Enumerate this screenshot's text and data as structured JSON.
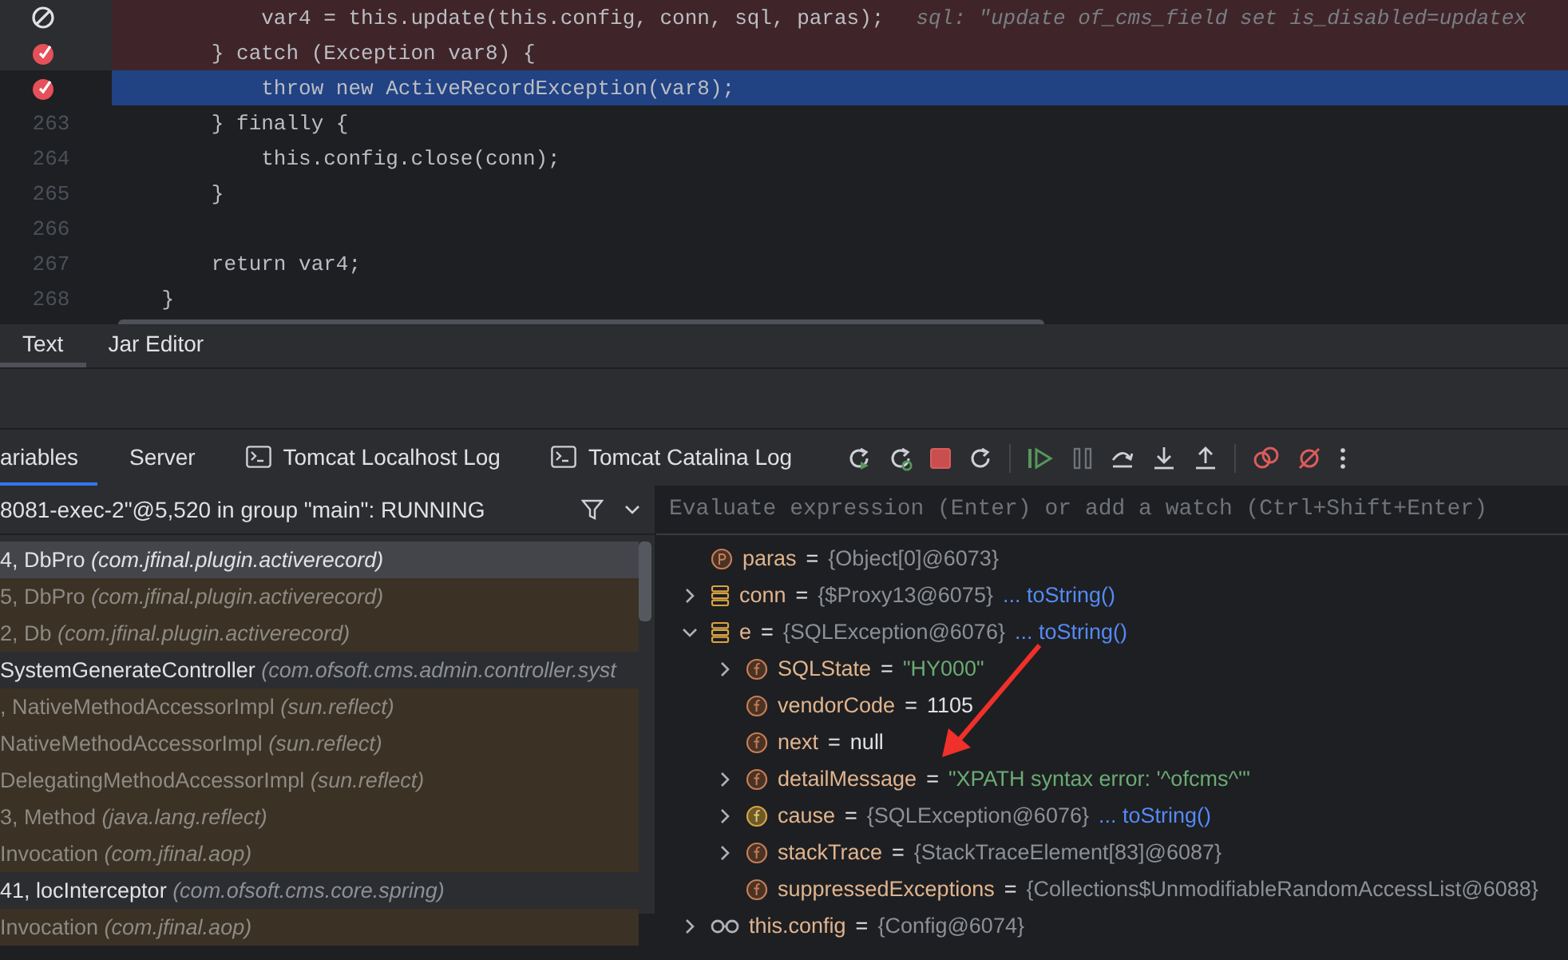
{
  "editor": {
    "lines": [
      {
        "breakpoint": true,
        "muted": true,
        "error": true,
        "current": false,
        "code": "            var4 = this.update(this.config, conn, sql, paras);",
        "hint": "sql: \"update of_cms_field set is_disabled=updatex"
      },
      {
        "breakpoint": true,
        "muted": false,
        "error": true,
        "current": false,
        "code": "        } catch (Exception var8) {"
      },
      {
        "breakpoint": true,
        "muted": false,
        "error": false,
        "current": true,
        "code": "            throw new ActiveRecordException(var8);"
      },
      {
        "number": "263",
        "breakpoint": false,
        "error": false,
        "current": false,
        "code": "        } finally {"
      },
      {
        "number": "264",
        "breakpoint": false,
        "error": false,
        "current": false,
        "code": "            this.config.close(conn);"
      },
      {
        "number": "265",
        "breakpoint": false,
        "error": false,
        "current": false,
        "code": "        }"
      },
      {
        "number": "266",
        "breakpoint": false
      },
      {
        "number": "267",
        "breakpoint": false,
        "error": false,
        "current": false,
        "code": "        return var4;"
      },
      {
        "number": "268",
        "breakpoint": false,
        "error": false,
        "current": false,
        "code": "    }"
      }
    ]
  },
  "editor_tabs": [
    {
      "label": "Text",
      "selected": true
    },
    {
      "label": "Jar Editor",
      "selected": false
    }
  ],
  "debug_tabs": [
    {
      "label": "ariables",
      "kind": "view",
      "selected": true
    },
    {
      "label": "Server",
      "kind": "view",
      "selected": false
    },
    {
      "label": "Tomcat Localhost Log",
      "kind": "log",
      "selected": false
    },
    {
      "label": "Tomcat Catalina Log",
      "kind": "log",
      "selected": false
    }
  ],
  "thread": {
    "label": "8081-exec-2\"@5,520 in group \"main\": RUNNING"
  },
  "evaluate": {
    "placeholder": "Evaluate expression (Enter) or add a watch (Ctrl+Shift+Enter)"
  },
  "frames": [
    {
      "method": "4, DbPro",
      "package": "(com.jfinal.plugin.activerecord)",
      "kind": "app",
      "selected": true
    },
    {
      "method": "5, DbPro",
      "package": "(com.jfinal.plugin.activerecord)",
      "kind": "library",
      "selected": false
    },
    {
      "method": "2, Db",
      "package": "(com.jfinal.plugin.activerecord)",
      "kind": "library",
      "selected": false
    },
    {
      "method": "SystemGenerateController",
      "package": "(com.ofsoft.cms.admin.controller.syst",
      "kind": "app",
      "selected": false
    },
    {
      "method": ", NativeMethodAccessorImpl",
      "package": "(sun.reflect)",
      "kind": "library",
      "selected": false
    },
    {
      "method": "NativeMethodAccessorImpl",
      "package": "(sun.reflect)",
      "kind": "library",
      "selected": false
    },
    {
      "method": "DelegatingMethodAccessorImpl",
      "package": "(sun.reflect)",
      "kind": "library",
      "selected": false
    },
    {
      "method": "3, Method",
      "package": "(java.lang.reflect)",
      "kind": "library",
      "selected": false
    },
    {
      "method": "Invocation",
      "package": "(com.jfinal.aop)",
      "kind": "library",
      "selected": false
    },
    {
      "method": "41, locInterceptor",
      "package": "(com.ofsoft.cms.core.spring)",
      "kind": "app",
      "selected": false
    },
    {
      "method": "Invocation",
      "package": "(com.jfinal.aop)",
      "kind": "library",
      "selected": false
    }
  ],
  "variables": [
    {
      "kind": "parameter",
      "name": "paras",
      "operator": "=",
      "value": "{Object[0]@6073}",
      "string": false,
      "primitive": false
    },
    {
      "kind": "object",
      "expanded": false,
      "name": "conn",
      "operator": "=",
      "value": "{$Proxy13@6075}",
      "string": false,
      "primitive": false,
      "link": "... toString()"
    },
    {
      "kind": "object",
      "expanded": true,
      "name": "e",
      "operator": "=",
      "value": "{SQLException@6076}",
      "string": false,
      "primitive": false,
      "link": "... toString()",
      "children": [
        {
          "kind": "field",
          "expanded": false,
          "name": "SQLState",
          "operator": "=",
          "value": "\"HY000\"",
          "string": true,
          "primitive": false
        },
        {
          "kind": "field",
          "name": "vendorCode",
          "operator": "=",
          "value": "1105",
          "string": false,
          "primitive": true
        },
        {
          "kind": "field",
          "name": "next",
          "operator": "=",
          "value": "null",
          "string": false,
          "primitive": true
        },
        {
          "kind": "field",
          "expanded": false,
          "name": "detailMessage",
          "operator": "=",
          "value": "\"XPATH syntax error: '^ofcms^'\"",
          "string": true,
          "primitive": false
        },
        {
          "kind": "field-recursive",
          "expanded": false,
          "name": "cause",
          "operator": "=",
          "value": "{SQLException@6076}",
          "string": false,
          "primitive": false,
          "link": "... toString()"
        },
        {
          "kind": "field",
          "expanded": false,
          "name": "stackTrace",
          "operator": "=",
          "value": "{StackTraceElement[83]@6087}",
          "string": false,
          "primitive": false
        },
        {
          "kind": "field",
          "name": "suppressedExceptions",
          "operator": "=",
          "value": "{Collections$UnmodifiableRandomAccessList@6088}",
          "string": false,
          "primitive": false
        }
      ]
    },
    {
      "kind": "watch",
      "expanded": false,
      "name": "this.config",
      "operator": "=",
      "value": "{Config@6074}",
      "string": false,
      "primitive": false
    }
  ]
}
